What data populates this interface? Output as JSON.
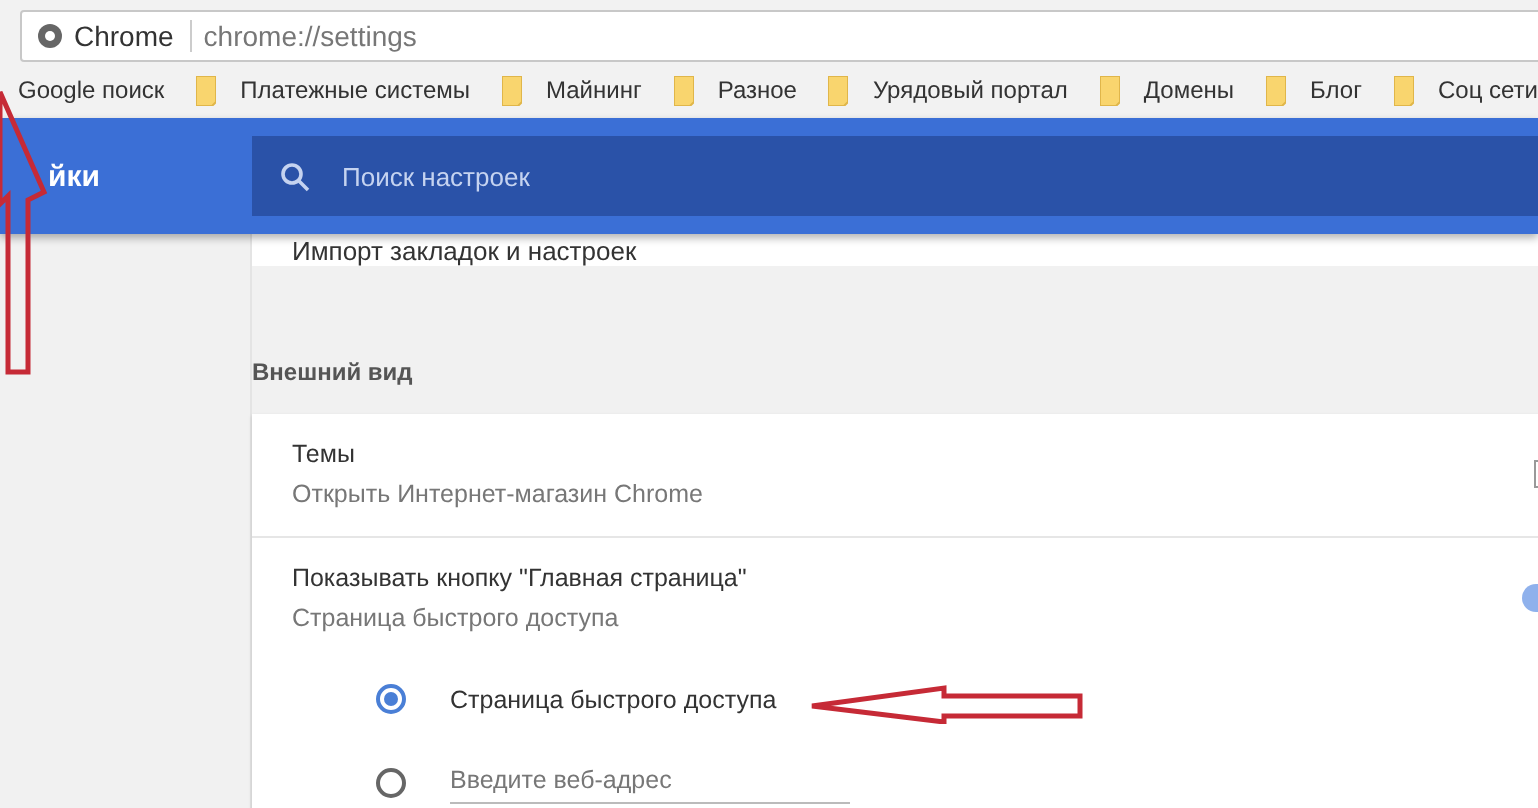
{
  "address_bar": {
    "site_label": "Chrome",
    "url": "chrome://settings"
  },
  "bookmarks": [
    {
      "label": "Google поиск",
      "kind": "plain"
    },
    {
      "label": "Платежные системы",
      "kind": "folder"
    },
    {
      "label": "Майнинг",
      "kind": "folder"
    },
    {
      "label": "Разное",
      "kind": "folder"
    },
    {
      "label": "Урядовый портал",
      "kind": "folder"
    },
    {
      "label": "Домены",
      "kind": "folder"
    },
    {
      "label": "Блог",
      "kind": "folder"
    },
    {
      "label": "Соц сети",
      "kind": "folder"
    }
  ],
  "header": {
    "title": "йки",
    "search_placeholder": "Поиск настроек"
  },
  "partial_row": "Импорт закладок и настроек",
  "section": {
    "title": "Внешний вид",
    "themes": {
      "title": "Темы",
      "subtitle": "Открыть Интернет-магазин Chrome"
    },
    "home_button": {
      "title": "Показывать кнопку \"Главная страница\"",
      "subtitle": "Страница быстрого доступа",
      "on": true
    },
    "options": [
      {
        "label": "Страница быстрого доступа",
        "kind": "radio",
        "selected": true
      },
      {
        "placeholder": "Введите веб-адрес",
        "kind": "url",
        "selected": false
      }
    ]
  }
}
